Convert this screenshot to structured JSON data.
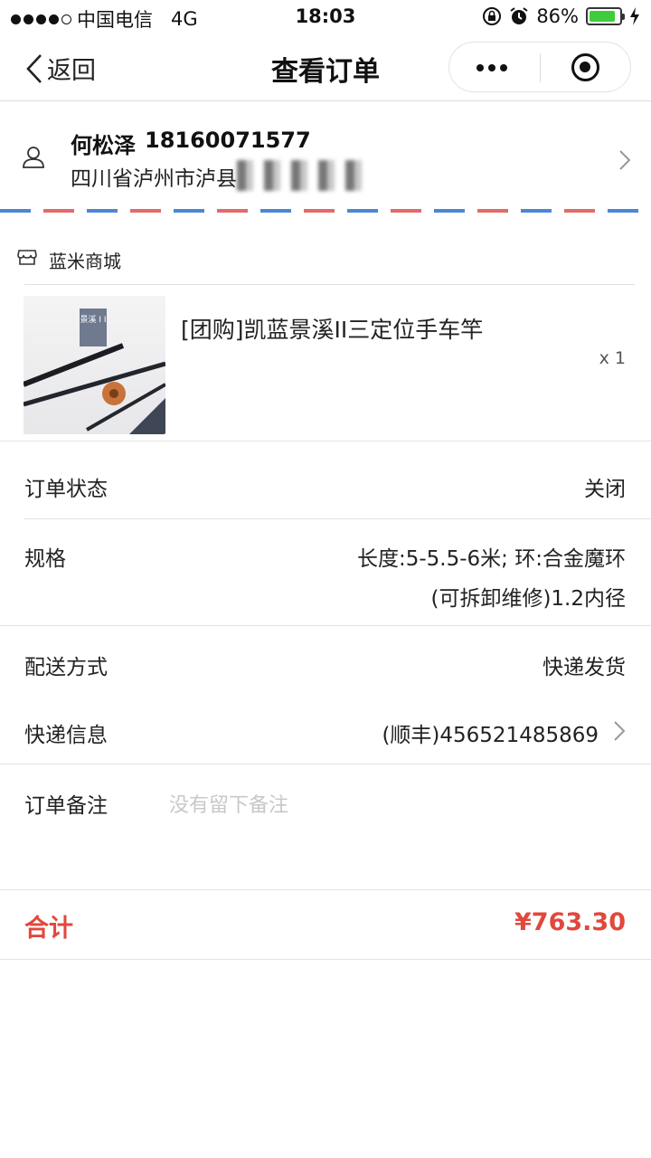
{
  "status_bar": {
    "carrier": "中国电信",
    "network": "4G",
    "time": "18:03",
    "battery": "86%",
    "battery_level": 0.86
  },
  "nav": {
    "back_label": "返回",
    "title": "查看订单"
  },
  "address": {
    "name": "何松泽",
    "phone": "18160071577",
    "address": "四川省泸州市泸县"
  },
  "store": {
    "name": "蓝米商城"
  },
  "product": {
    "title": "[团购]凯蓝景溪II三定位手车竿",
    "quantity": "x 1",
    "thumb_label": "景溪 I I"
  },
  "details": {
    "status_label": "订单状态",
    "status_value": "关闭",
    "spec_label": "规格",
    "spec_line1": "长度:5-5.5-6米; 环:合金魔环",
    "spec_line2": "(可拆卸维修)1.2内径",
    "delivery_label": "配送方式",
    "delivery_value": "快递发货",
    "express_label": "快递信息",
    "express_value": "(顺丰)456521485869",
    "remark_label": "订单备注",
    "remark_placeholder": "没有留下备注"
  },
  "total": {
    "label": "合计",
    "value": "¥763.30"
  },
  "colors": {
    "accent_red": "#e2473d",
    "envelope_blue": "#4c86d6",
    "envelope_red": "#e46a6a"
  }
}
